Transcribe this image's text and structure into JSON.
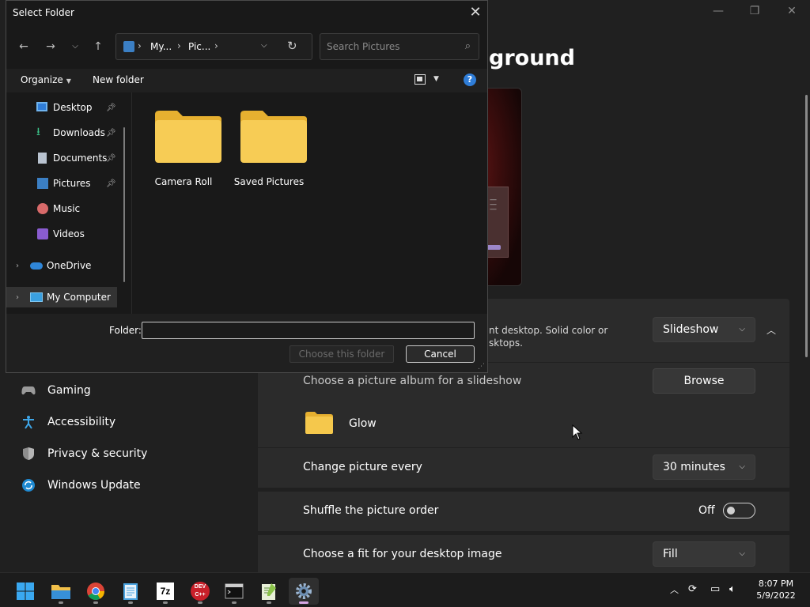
{
  "settings": {
    "page_title": "ground",
    "window_controls": {
      "minimize": "—",
      "maximize": "❐",
      "close": "✕"
    },
    "personalize_card": {
      "description": "nt desktop. Solid color or\nsktops.",
      "dropdown_value": "Slideshow"
    },
    "album": {
      "label": "Choose a picture album for a slideshow",
      "browse_label": "Browse",
      "folder_name": "Glow"
    },
    "change_picture": {
      "label": "Change picture every",
      "value": "30 minutes"
    },
    "shuffle": {
      "label": "Shuffle the picture order",
      "state": "Off"
    },
    "fit": {
      "label": "Choose a fit for your desktop image",
      "value": "Fill"
    },
    "nav": [
      {
        "label": "Gaming",
        "icon": "gamepad-icon"
      },
      {
        "label": "Accessibility",
        "icon": "accessibility-icon"
      },
      {
        "label": "Privacy & security",
        "icon": "shield-icon"
      },
      {
        "label": "Windows Update",
        "icon": "windows-update-icon"
      }
    ]
  },
  "dialog": {
    "title": "Select Folder",
    "address": {
      "crumbs": [
        "My...",
        "Pic..."
      ]
    },
    "search_placeholder": "Search Pictures",
    "toolbar": {
      "organize": "Organize",
      "new_folder": "New folder",
      "help": "?"
    },
    "tree": [
      {
        "label": "Desktop",
        "icon": "desktop-icon",
        "pinned": true
      },
      {
        "label": "Downloads",
        "icon": "download-icon",
        "pinned": true
      },
      {
        "label": "Documents",
        "icon": "documents-icon",
        "pinned": true
      },
      {
        "label": "Pictures",
        "icon": "pictures-icon",
        "pinned": true
      },
      {
        "label": "Music",
        "icon": "music-icon",
        "pinned": false
      },
      {
        "label": "Videos",
        "icon": "videos-icon",
        "pinned": false
      },
      {
        "label": "OneDrive",
        "icon": "onedrive-icon",
        "expandable": true
      },
      {
        "label": "My Computer",
        "icon": "computer-icon",
        "expandable": true,
        "selected": true
      }
    ],
    "folders": [
      {
        "name": "Camera Roll"
      },
      {
        "name": "Saved Pictures"
      }
    ],
    "footer": {
      "folder_label": "Folder:",
      "folder_value": "",
      "choose_label": "Choose this folder",
      "cancel_label": "Cancel"
    }
  },
  "taskbar": {
    "apps": [
      {
        "name": "Start",
        "icon": "windows-start-icon"
      },
      {
        "name": "File Explorer",
        "icon": "file-explorer-icon"
      },
      {
        "name": "Chrome",
        "icon": "chrome-icon"
      },
      {
        "name": "Notepad",
        "icon": "notepad-icon"
      },
      {
        "name": "7-Zip",
        "icon": "7zip-icon",
        "text": "7z"
      },
      {
        "name": "Dev-C++",
        "icon": "devcpp-icon",
        "text": "DEV C++"
      },
      {
        "name": "Terminal",
        "icon": "terminal-icon"
      },
      {
        "name": "Notepad++",
        "icon": "notepadpp-icon"
      },
      {
        "name": "Settings",
        "icon": "settings-icon",
        "active": true
      }
    ],
    "time": "8:07 PM",
    "date": "5/9/2022"
  },
  "colors": {
    "accent": "#2f7dd8",
    "folder_yellow": "#f5c84c",
    "taskbar_active": "#d6a6e4"
  }
}
